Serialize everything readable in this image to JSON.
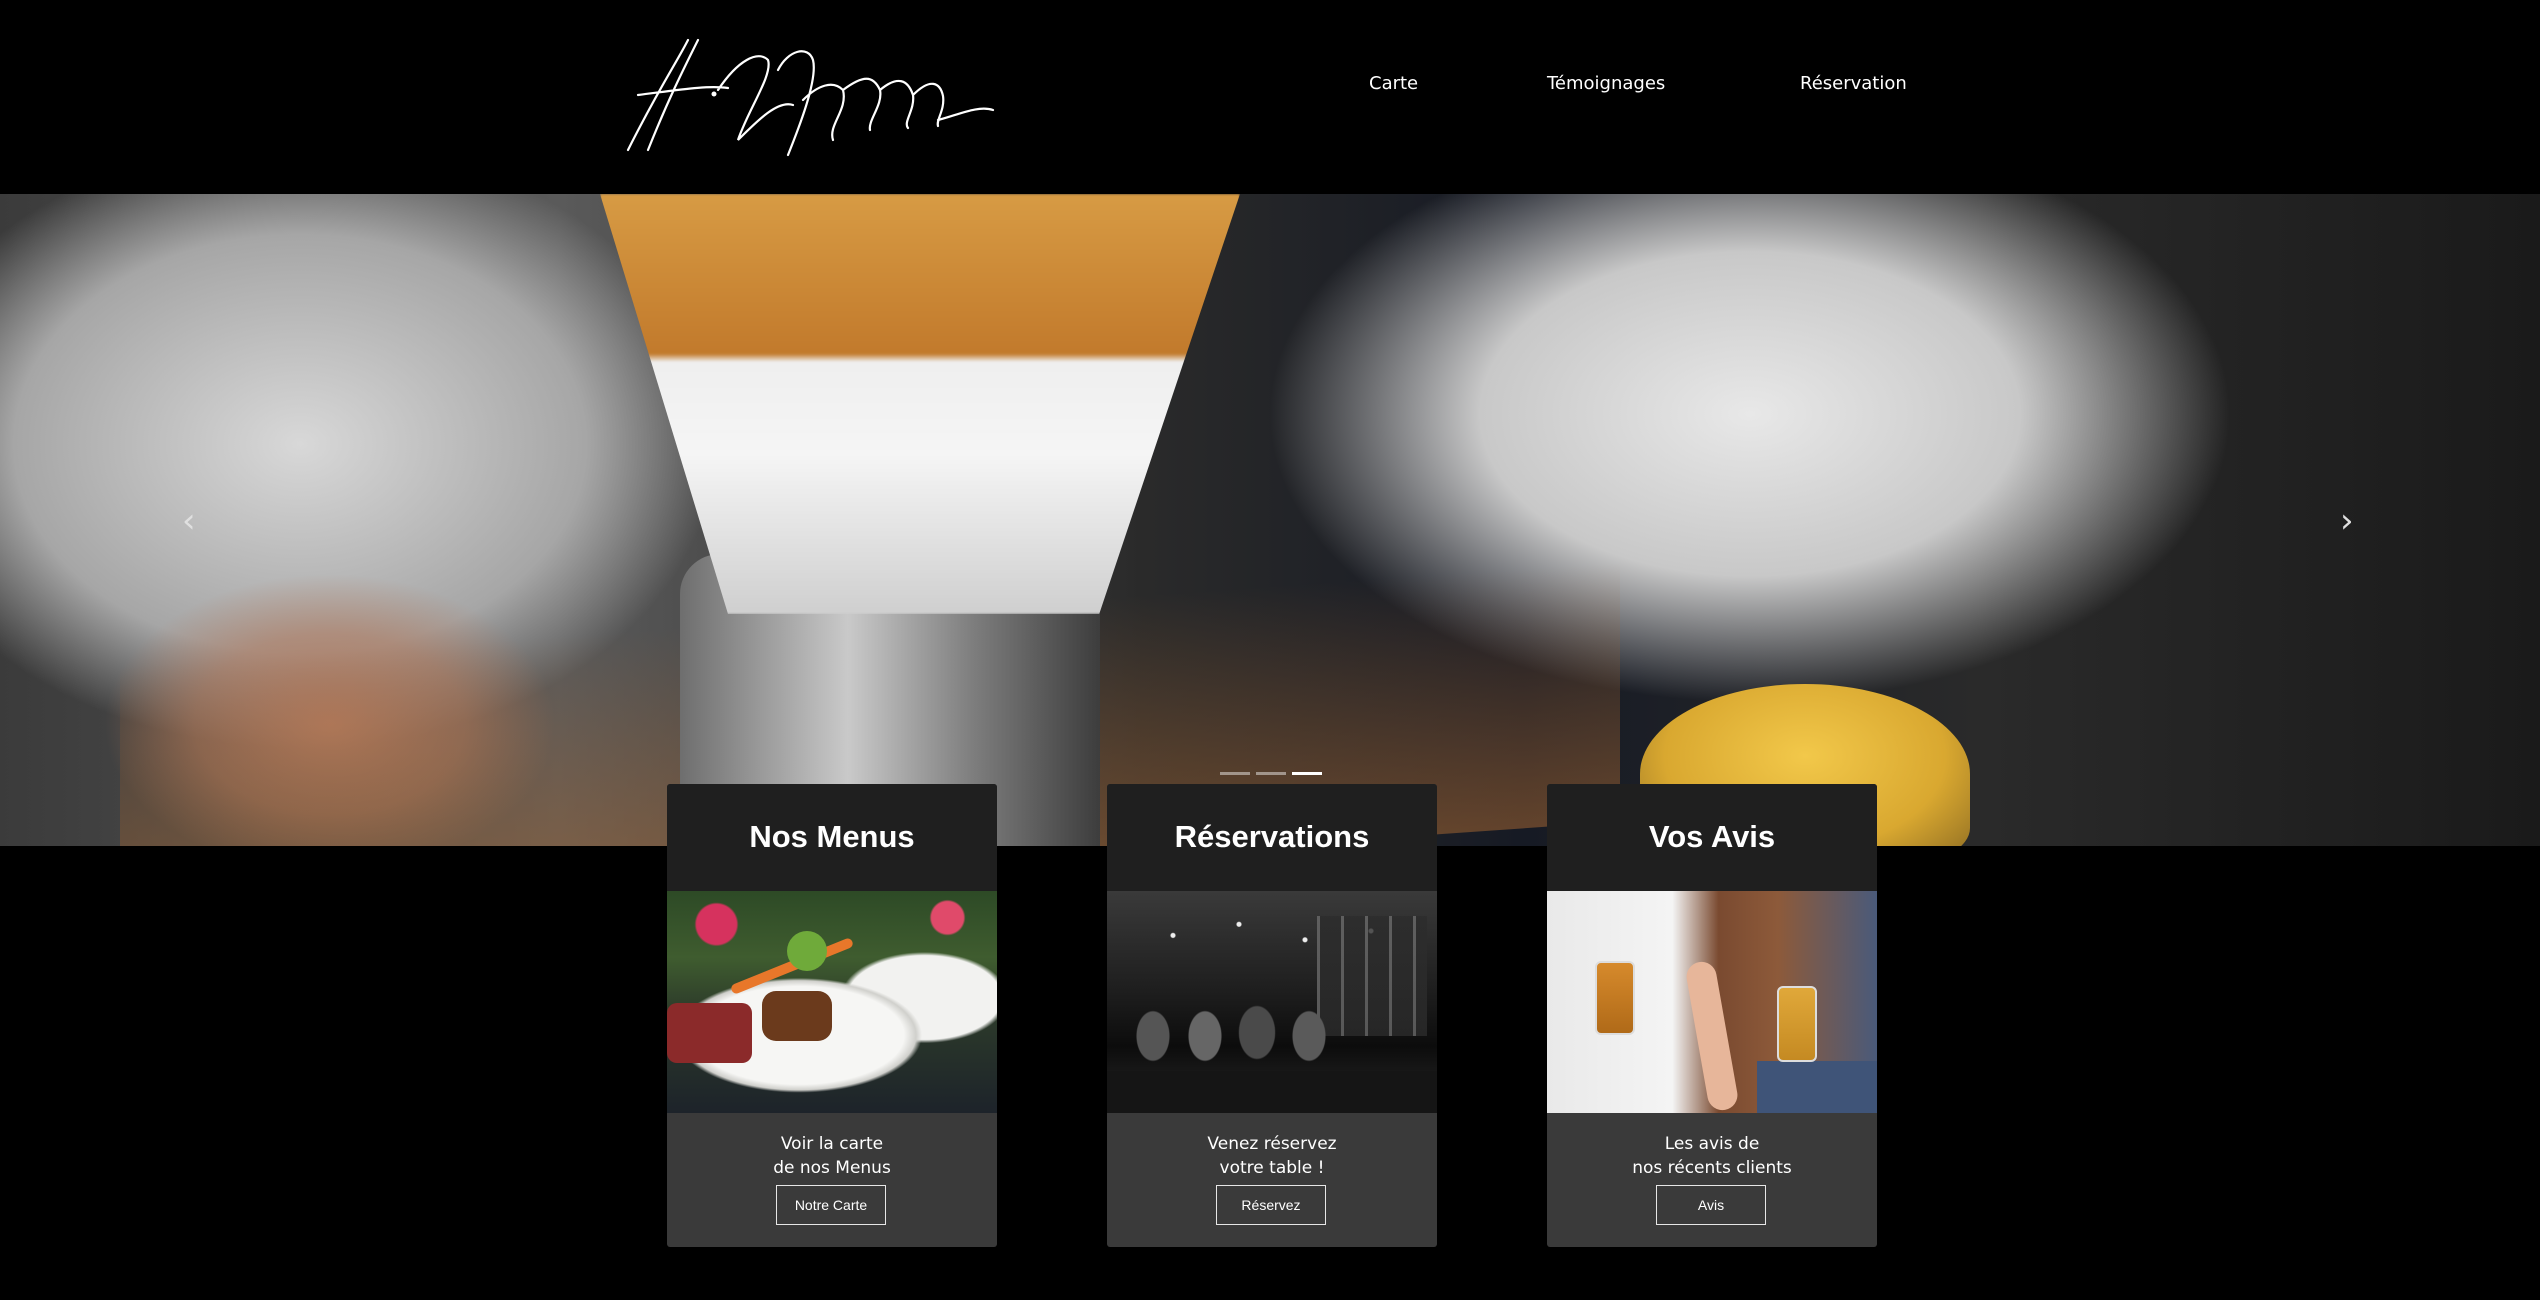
{
  "header": {
    "logo_name": "signature-logo",
    "nav": [
      {
        "label": "Carte"
      },
      {
        "label": "Témoignages"
      },
      {
        "label": "Réservation"
      }
    ]
  },
  "hero": {
    "prev_icon": "chevron-left-icon",
    "next_icon": "chevron-right-icon",
    "prev_glyph": "‹",
    "next_glyph": "›",
    "slides_count": 3,
    "active_slide": 3
  },
  "cards": [
    {
      "title": "Nos Menus",
      "line1": "Voir la carte",
      "line2": "de nos Menus",
      "button": "Notre Carte"
    },
    {
      "title": "Réservations",
      "line1": "Venez réservez",
      "line2": "votre table !",
      "button": "Réservez"
    },
    {
      "title": "Vos Avis",
      "line1": "Les avis de",
      "line2": "nos récents clients",
      "button": "Avis"
    }
  ],
  "colors": {
    "background": "#000000",
    "card_header": "#1f1f1f",
    "card_body": "#3a3a3a",
    "text": "#ffffff"
  }
}
